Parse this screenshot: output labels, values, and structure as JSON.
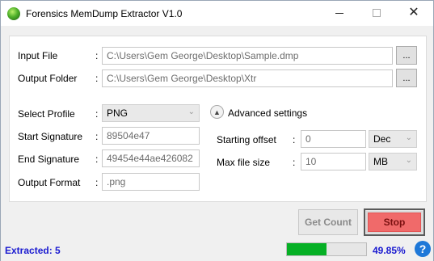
{
  "window": {
    "title": "Forensics MemDump Extractor V1.0",
    "controls": {
      "minimize": "–",
      "maximize": "☐",
      "close": "✕"
    }
  },
  "files": {
    "input_label": "Input File",
    "input_value": "C:\\Users\\Gem George\\Desktop\\Sample.dmp",
    "output_label": "Output Folder",
    "output_value": "C:\\Users\\Gem George\\Desktop\\Xtr",
    "browse_label": "..."
  },
  "profile": {
    "select_label": "Select Profile",
    "select_value": "PNG",
    "start_label": "Start Signature",
    "start_value": "89504e47",
    "end_label": "End Signature",
    "end_value": "49454e44ae426082",
    "format_label": "Output Format",
    "format_value": ".png"
  },
  "advanced": {
    "toggle_label": "Advanced settings",
    "offset_label": "Starting offset",
    "offset_value": "0",
    "offset_unit": "Dec",
    "size_label": "Max file size",
    "size_value": "10",
    "size_unit": "MB"
  },
  "actions": {
    "get_count": "Get Count",
    "stop": "Stop"
  },
  "status": {
    "extracted": "Extracted: 5",
    "progress_percent_text": "49.85%",
    "progress_fraction": 0.4985,
    "help": "?"
  },
  "colors": {
    "accent_text": "#1a1ad0",
    "progress": "#06b025",
    "stop_button": "#f06a6a",
    "help_icon": "#1e78d8"
  }
}
